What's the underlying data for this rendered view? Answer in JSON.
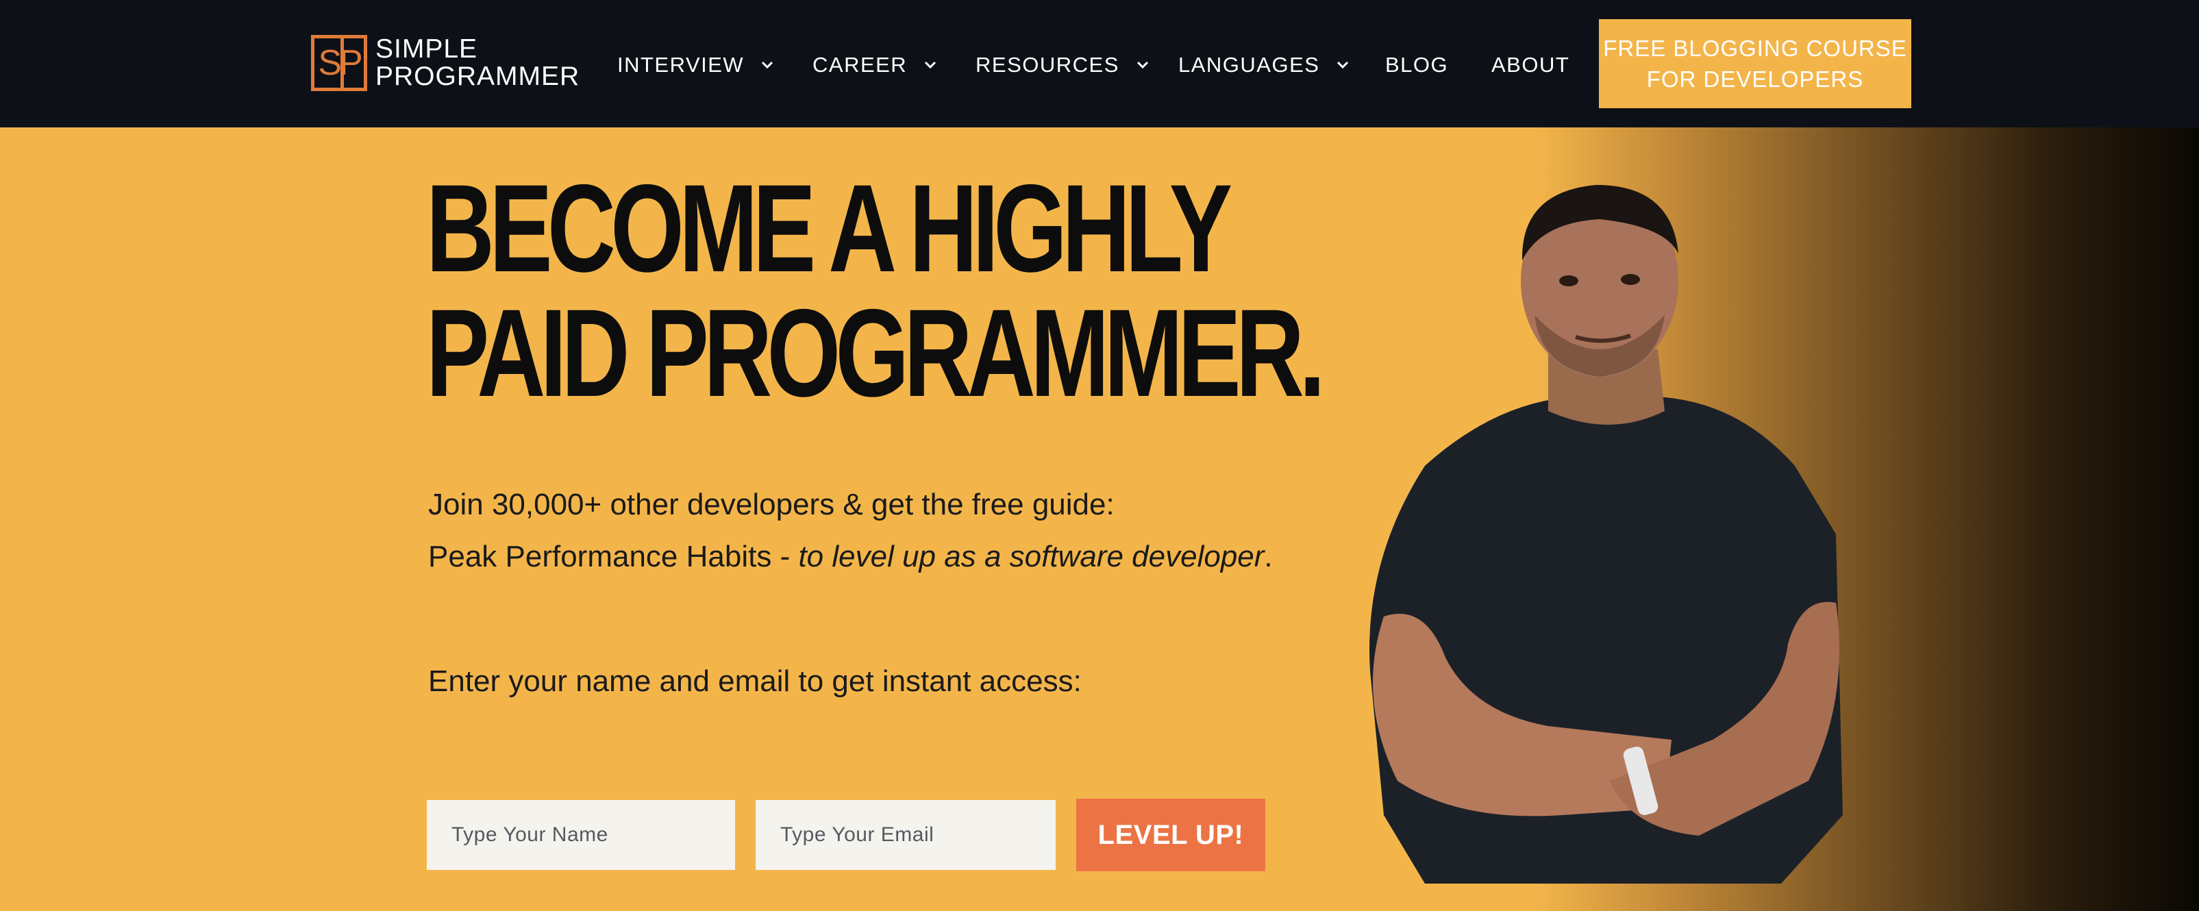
{
  "nav": {
    "logo": {
      "line1": "SIMPLE",
      "line2": "PROGRAMMER",
      "mark": "SP"
    },
    "items": [
      {
        "label": "INTERVIEW",
        "has_dropdown": true
      },
      {
        "label": "CAREER",
        "has_dropdown": true
      },
      {
        "label": "RESOURCES",
        "has_dropdown": true
      },
      {
        "label": "LANGUAGES",
        "has_dropdown": true
      },
      {
        "label": "BLOG",
        "has_dropdown": false
      },
      {
        "label": "ABOUT",
        "has_dropdown": false
      }
    ],
    "cta": {
      "line1": "FREE BLOGGING COURSE",
      "line2": "FOR DEVELOPERS"
    }
  },
  "hero": {
    "headline_line1": "BECOME A HIGHLY",
    "headline_line2": "PAID PROGRAMMER.",
    "join_text": "Join 30,000+ other developers & get the free guide:",
    "guide_name": "Peak Performance Habits - ",
    "guide_tagline": "to level up as a software developer",
    "guide_end": ".",
    "access_prompt": "Enter your name and email to get instant access:",
    "form": {
      "name_placeholder": "Type Your Name",
      "email_placeholder": "Type Your Email",
      "submit_label": "LEVEL UP!"
    }
  },
  "colors": {
    "nav_bg": "#0d1117",
    "brand_yellow": "#f3b54a",
    "logo_orange": "#e07b3a",
    "submit_orange": "#ec7444",
    "input_bg": "#f4f3ee"
  },
  "icons": {
    "dropdown": "chevron-down-icon",
    "logo": "sp-logo-icon",
    "portrait": "portrait-image"
  }
}
